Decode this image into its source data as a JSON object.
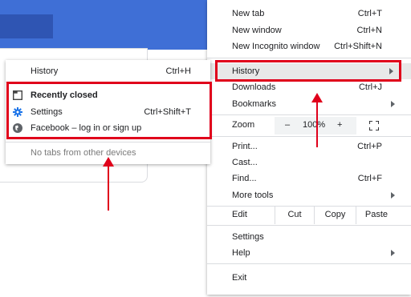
{
  "main_menu": {
    "new_tab": {
      "label": "New tab",
      "shortcut": "Ctrl+T"
    },
    "new_window": {
      "label": "New window",
      "shortcut": "Ctrl+N"
    },
    "new_incognito": {
      "label": "New Incognito window",
      "shortcut": "Ctrl+Shift+N"
    },
    "history": {
      "label": "History"
    },
    "downloads": {
      "label": "Downloads",
      "shortcut": "Ctrl+J"
    },
    "bookmarks": {
      "label": "Bookmarks"
    },
    "zoom": {
      "label": "Zoom",
      "minus": "–",
      "value": "100%",
      "plus": "+"
    },
    "print": {
      "label": "Print...",
      "shortcut": "Ctrl+P"
    },
    "cast": {
      "label": "Cast..."
    },
    "find": {
      "label": "Find...",
      "shortcut": "Ctrl+F"
    },
    "more_tools": {
      "label": "More tools"
    },
    "edit": {
      "label": "Edit",
      "cut": "Cut",
      "copy": "Copy",
      "paste": "Paste"
    },
    "settings": {
      "label": "Settings"
    },
    "help": {
      "label": "Help"
    },
    "exit": {
      "label": "Exit"
    }
  },
  "history_submenu": {
    "history": {
      "label": "History",
      "shortcut": "Ctrl+H"
    },
    "recently_closed": {
      "label": "Recently closed"
    },
    "settings": {
      "label": "Settings",
      "shortcut": "Ctrl+Shift+T"
    },
    "facebook": {
      "label": "Facebook – log in or sign up"
    },
    "no_tabs": {
      "label": "No tabs from other devices"
    }
  },
  "colors": {
    "highlight_red": "#e0001b",
    "header_blue": "#3f6fd6",
    "gear_blue": "#1a73e8"
  }
}
